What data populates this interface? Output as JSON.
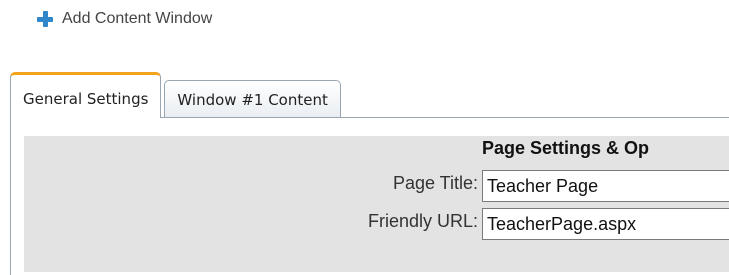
{
  "toolbar": {
    "add_window_label": "Add Content Window",
    "add_icon": "plus-icon",
    "accent_color": "#2f86c9"
  },
  "tabs": [
    {
      "label": "General Settings",
      "active": true
    },
    {
      "label": "Window #1 Content",
      "active": false
    }
  ],
  "active_tab_accent": "#f2a31c",
  "page_settings": {
    "section_title": "Page Settings & Op",
    "page_title_label": "Page Title:",
    "page_title_value": "Teacher Page",
    "friendly_url_label": "Friendly URL:",
    "friendly_url_value": "TeacherPage.aspx"
  }
}
